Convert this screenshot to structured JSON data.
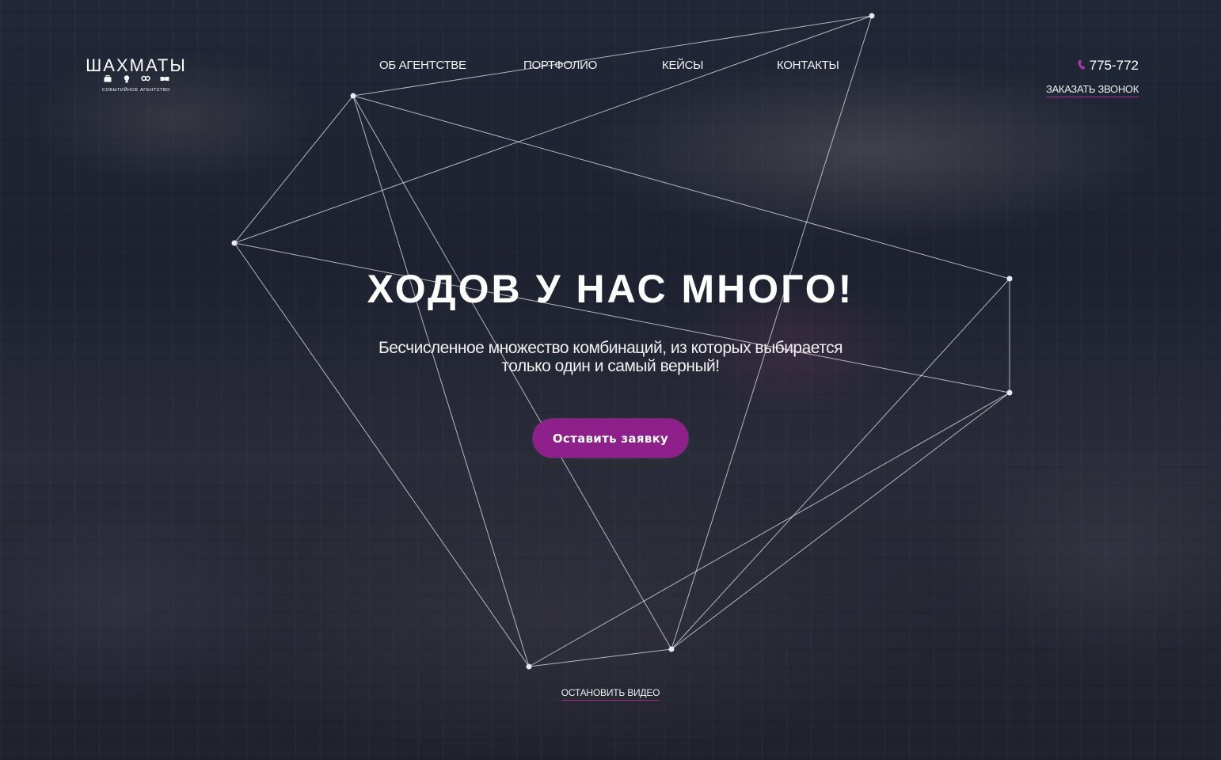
{
  "logo": {
    "title": "ШАХМАТЫ",
    "subtitle": "СОБЫТИЙНОЕ АГЕНТСТВО",
    "icons": [
      "briefcase-icon",
      "lightbulb-icon",
      "link-icon",
      "puzzle-icon"
    ]
  },
  "nav": {
    "items": [
      {
        "label": "ОБ АГЕНТСТВЕ"
      },
      {
        "label": "ПОРТФОЛИО"
      },
      {
        "label": "КЕЙСЫ"
      },
      {
        "label": "КОНТАКТЫ"
      }
    ]
  },
  "contact": {
    "phone": "775-772",
    "callback_label": "ЗАКАЗАТЬ ЗВОНОК"
  },
  "hero": {
    "title": "ХОДОВ У НАС МНОГО!",
    "subtitle_line1": "Бесчисленное множество комбинаций, из которых выбирается",
    "subtitle_line2": "только один и самый верный!",
    "cta_label": "Оставить заявку"
  },
  "video": {
    "stop_label": "ОСТАНОВИТЬ ВИДЕО"
  },
  "colors": {
    "accent": "#8f1f8b",
    "underline": "#a12c98",
    "text": "#ffffff"
  }
}
